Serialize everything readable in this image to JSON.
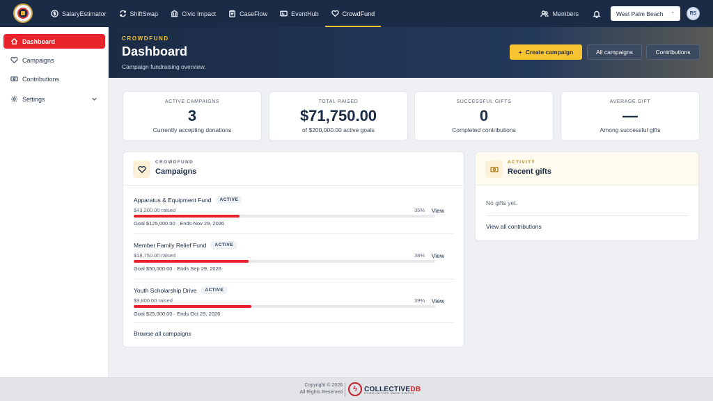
{
  "nav": {
    "items": [
      {
        "label": "SalaryEstimator",
        "icon": "dollar-icon"
      },
      {
        "label": "ShiftSwap",
        "icon": "swap-icon"
      },
      {
        "label": "Civic Impact",
        "icon": "building-icon"
      },
      {
        "label": "CaseFlow",
        "icon": "clipboard-icon"
      },
      {
        "label": "EventHub",
        "icon": "ticket-icon"
      },
      {
        "label": "CrowdFund",
        "icon": "heart-icon",
        "active": true
      }
    ],
    "members_label": "Members",
    "city": "West Palm Beach",
    "avatar_initials": "RS"
  },
  "sidebar": {
    "items": [
      {
        "label": "Dashboard",
        "icon": "home-icon",
        "active": true
      },
      {
        "label": "Campaigns",
        "icon": "heart-icon"
      },
      {
        "label": "Contributions",
        "icon": "money-icon"
      },
      {
        "label": "Settings",
        "icon": "gear-icon",
        "expandable": true
      }
    ]
  },
  "hero": {
    "kicker": "CROWDFUND",
    "title": "Dashboard",
    "subtitle": "Campaign fundraising overview.",
    "create_label": "Create campaign",
    "all_campaigns_label": "All campaigns",
    "contributions_label": "Contributions"
  },
  "stats": [
    {
      "label": "ACTIVE CAMPAIGNS",
      "value": "3",
      "sub": "Currently accepting donations"
    },
    {
      "label": "TOTAL RAISED",
      "value": "$71,750.00",
      "sub": "of $200,000.00 active goals"
    },
    {
      "label": "SUCCESSFUL GIFTS",
      "value": "0",
      "sub": "Completed contributions"
    },
    {
      "label": "AVERAGE GIFT",
      "value": "—",
      "sub": "Among successful gifts"
    }
  ],
  "campaigns_panel": {
    "kicker": "CROWDFUND",
    "title": "Campaigns",
    "browse_label": "Browse all campaigns",
    "view_label": "View",
    "items": [
      {
        "name": "Apparatus & Equipment Fund",
        "status": "ACTIVE",
        "raised": "$43,200.00 raised",
        "pct_label": "35%",
        "progress": 0.35,
        "meta": "Goal $125,000.00 · Ends Nov 29, 2026"
      },
      {
        "name": "Member Family Relief Fund",
        "status": "ACTIVE",
        "raised": "$18,750.00 raised",
        "pct_label": "38%",
        "progress": 0.38,
        "meta": "Goal $50,000.00 · Ends Sep 29, 2026"
      },
      {
        "name": "Youth Scholarship Drive",
        "status": "ACTIVE",
        "raised": "$9,800.00 raised",
        "pct_label": "39%",
        "progress": 0.39,
        "meta": "Goal $25,000.00 · Ends Oct 29, 2026"
      }
    ]
  },
  "gifts_panel": {
    "kicker": "ACTIVITY",
    "title": "Recent gifts",
    "empty": "No gifts yet.",
    "view_all_label": "View all contributions"
  },
  "footer": {
    "copyright_line1": "Copyright © 2026",
    "copyright_line2": "All Rights Reserved",
    "brand_main": "COLLECTIVE",
    "brand_accent": "DB",
    "brand_tagline": "COMMUNITIES MADE SIMPLE"
  },
  "colors": {
    "navy": "#1b2b45",
    "accent_red": "#e8232b",
    "accent_yellow": "#f6c331"
  }
}
